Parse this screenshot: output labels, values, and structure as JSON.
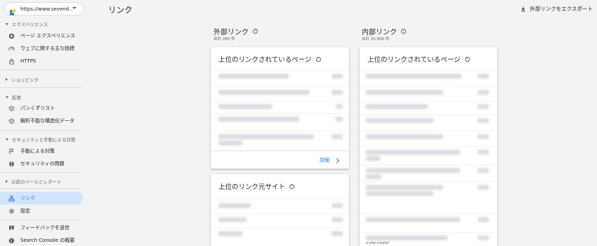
{
  "property": {
    "url": "https://www.sevend..."
  },
  "sidebar": {
    "sec_experience": "エクスペリエンス",
    "items_experience": [
      {
        "label": "ページ エクスペリエンス",
        "icon": "page-experience-icon"
      },
      {
        "label": "ウェブに関する主な指標",
        "icon": "speed-icon"
      },
      {
        "label": "HTTPS",
        "icon": "lock-icon"
      }
    ],
    "sec_shopping": "ショッピング",
    "sec_enhancements": "拡張",
    "items_enhancements": [
      {
        "label": "パンくずリスト",
        "icon": "layers-icon"
      },
      {
        "label": "解析不能な構造化データ",
        "icon": "layers-icon"
      }
    ],
    "sec_security": "セキュリティと手動による対策",
    "items_security": [
      {
        "label": "手動による対策",
        "icon": "flag-icon"
      },
      {
        "label": "セキュリティの問題",
        "icon": "shield-icon"
      }
    ],
    "sec_legacy": "以前のツールとレポート",
    "items_main": [
      {
        "label": "リンク",
        "icon": "links-icon"
      },
      {
        "label": "設定",
        "icon": "gear-icon"
      }
    ],
    "items_bottom": [
      {
        "label": "フィードバックを送信",
        "icon": "feedback-icon"
      },
      {
        "label": "Search Console の概要",
        "icon": "info-icon"
      }
    ]
  },
  "header": {
    "title": "リンク",
    "export_label": "外部リンクをエクスポート"
  },
  "external": {
    "heading": "外部リンク",
    "total": "合計 285 件",
    "top_pages": {
      "title": "上位のリンクされているページ",
      "detail": "詳細"
    },
    "top_sites": {
      "title": "上位のリンク元サイト"
    }
  },
  "internal": {
    "heading": "内部リンク",
    "total": "合計 25,906 件",
    "top_pages": {
      "title": "上位のリンクされているページ"
    },
    "snippet": "e-site-create/"
  },
  "colors": {
    "accent": "#1a73e8",
    "active_bg": "#d2e3fc",
    "page_bg": "#f1f3f4"
  }
}
